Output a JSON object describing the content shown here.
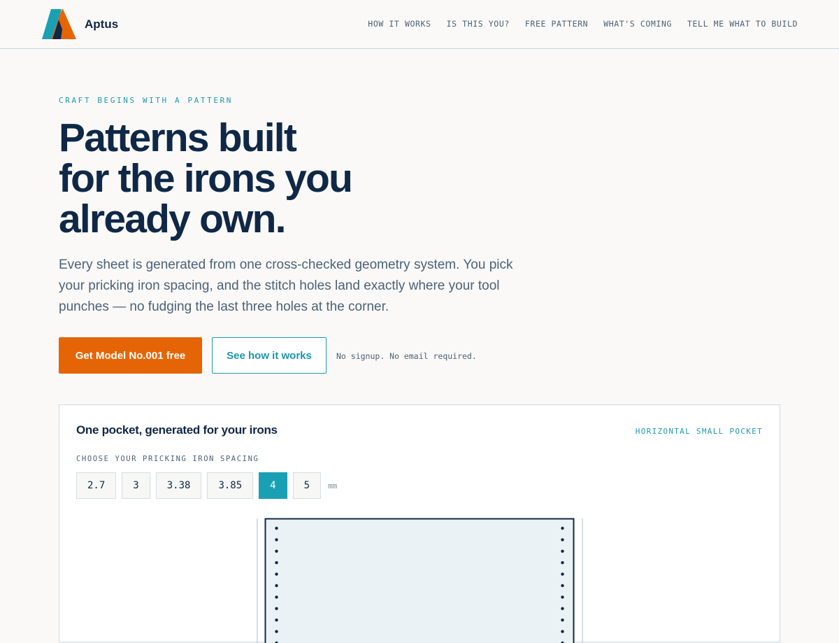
{
  "brand": {
    "name": "Aptus",
    "colors": {
      "teal": "#1aa0b4",
      "navy": "#0f2847",
      "orange": "#e56506"
    }
  },
  "nav": {
    "items": [
      {
        "label": "HOW IT WORKS"
      },
      {
        "label": "IS THIS YOU?"
      },
      {
        "label": "FREE PATTERN"
      },
      {
        "label": "WHAT'S COMING"
      },
      {
        "label": "TELL ME WHAT TO BUILD"
      }
    ]
  },
  "hero": {
    "eyebrow": "CRAFT BEGINS WITH A PATTERN",
    "headline_lines": [
      "Patterns built",
      "for the irons you",
      "already own."
    ],
    "lede_lines": [
      "Every sheet is generated from one cross-checked geometry system. You pick",
      "your pricking iron spacing, and the stitch holes land exactly where your tool",
      "punches — no fudging the last three holes at the corner."
    ],
    "primary_cta": "Get Model No.001 free",
    "secondary_cta": "See how it works",
    "cta_note": "No signup. No email required."
  },
  "generator": {
    "title": "One pocket, generated for your irons",
    "tag": "HORIZONTAL SMALL POCKET",
    "spacing_label": "CHOOSE YOUR PRICKING IRON SPACING",
    "spacing_options": [
      "2.7",
      "3",
      "3.38",
      "3.85",
      "4",
      "5"
    ],
    "selected_spacing": "4",
    "unit": "mm"
  }
}
